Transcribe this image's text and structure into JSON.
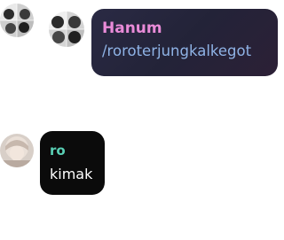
{
  "messages": [
    {
      "sender": "Hanum",
      "text": "/roroterjungkalkegot",
      "avatar": "avatar-icon",
      "sender_color": "#e98bd8",
      "text_color": "#8fb3e6",
      "bubble_color": "#262640"
    },
    {
      "sender": "ro",
      "text": "kimak",
      "avatar": "avatar-icon",
      "sender_color": "#59d0b5",
      "text_color": "#ffffff",
      "bubble_color": "#0b0b0b"
    }
  ],
  "extra_avatar": "avatar-icon"
}
